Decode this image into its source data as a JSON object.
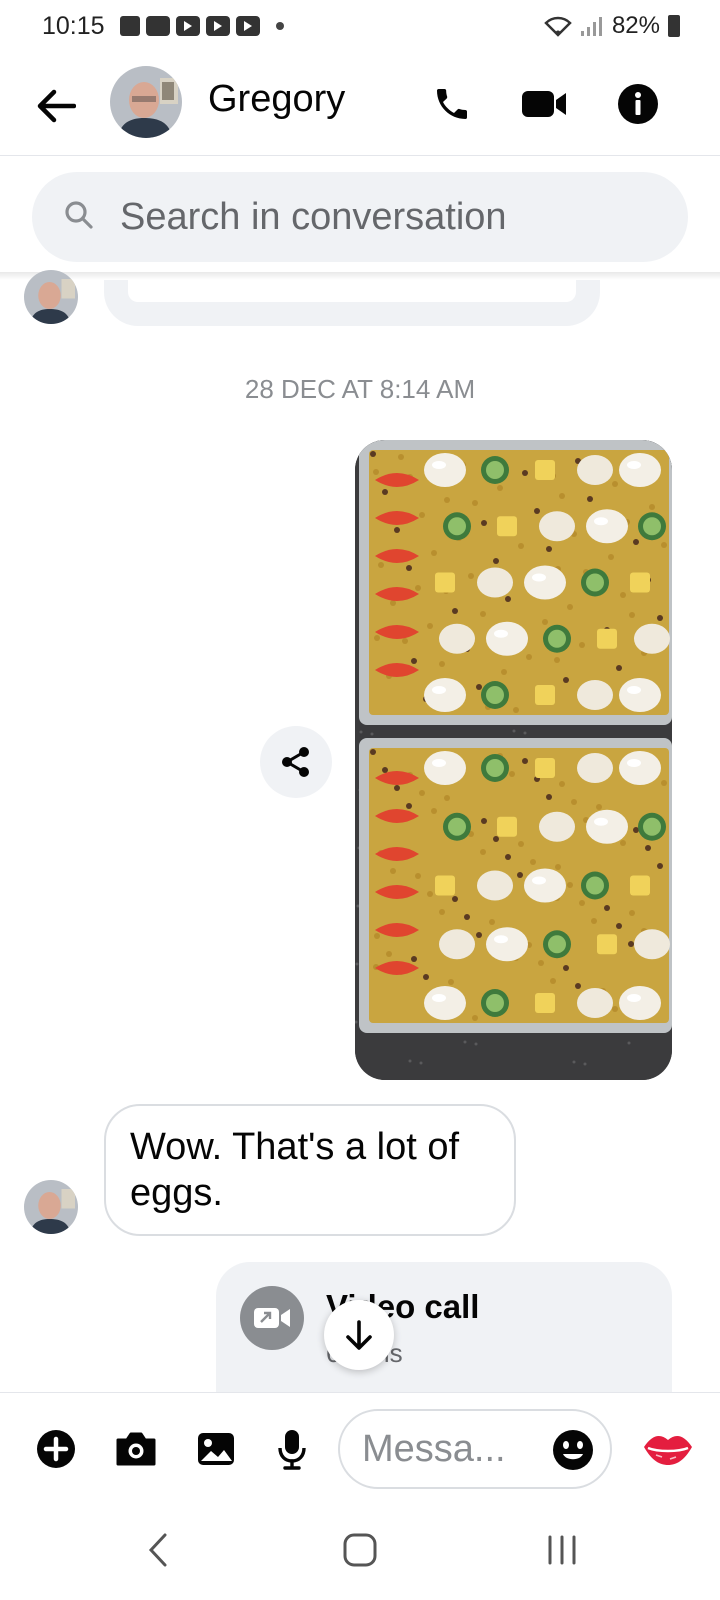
{
  "status_bar": {
    "time": "10:15",
    "battery": "82%"
  },
  "header": {
    "contact_name": "Gregory"
  },
  "search": {
    "placeholder": "Search in conversation"
  },
  "conversation": {
    "timestamp": "28 DEC AT 8:14 AM",
    "incoming_message": "Wow. That's a lot of eggs.",
    "call_card": {
      "title": "Video call",
      "subtitle": "6 mins"
    }
  },
  "composer": {
    "placeholder": "Messa..."
  },
  "icons": {
    "back": "arrow-left-icon",
    "call": "phone-icon",
    "video": "video-camera-icon",
    "info": "info-icon",
    "search": "search-icon",
    "share": "share-icon",
    "scroll": "arrow-down-icon",
    "plus": "plus-icon",
    "camera": "camera-icon",
    "gallery": "image-icon",
    "mic": "microphone-icon",
    "emoji": "emoji-icon",
    "kiss": "lips-icon"
  },
  "colors": {
    "bubble_gray": "#f0f2f5",
    "text": "#050505",
    "secondary_text": "#65676b",
    "kiss_red": "#e41e3f"
  }
}
